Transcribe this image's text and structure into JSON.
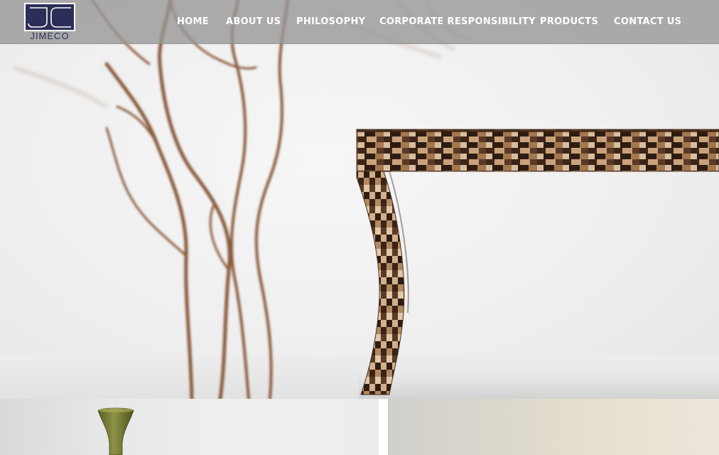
{
  "brand": {
    "name": "JIMECO",
    "logo_colors": {
      "mark": "#2c2e58",
      "outline": "#ffffff"
    }
  },
  "nav": {
    "items": [
      {
        "label": "HOME"
      },
      {
        "label": "ABOUT US"
      },
      {
        "label": "PHILOSOPHY"
      },
      {
        "label": "CORPORATE RESPONSIBILITY"
      },
      {
        "label": "PRODUCTS"
      },
      {
        "label": "CONTACT US"
      }
    ]
  },
  "hero": {
    "image": "console-table-with-branches",
    "icon": "photo-icon"
  },
  "tiles": [
    {
      "image": "green-vase-photo"
    },
    {
      "image": "warm-interior-photo"
    }
  ],
  "colors": {
    "header_bg": "#969696",
    "nav_text": "#ffffff",
    "branch": "#8a5a3c",
    "table_pattern": "#6b4a34"
  }
}
